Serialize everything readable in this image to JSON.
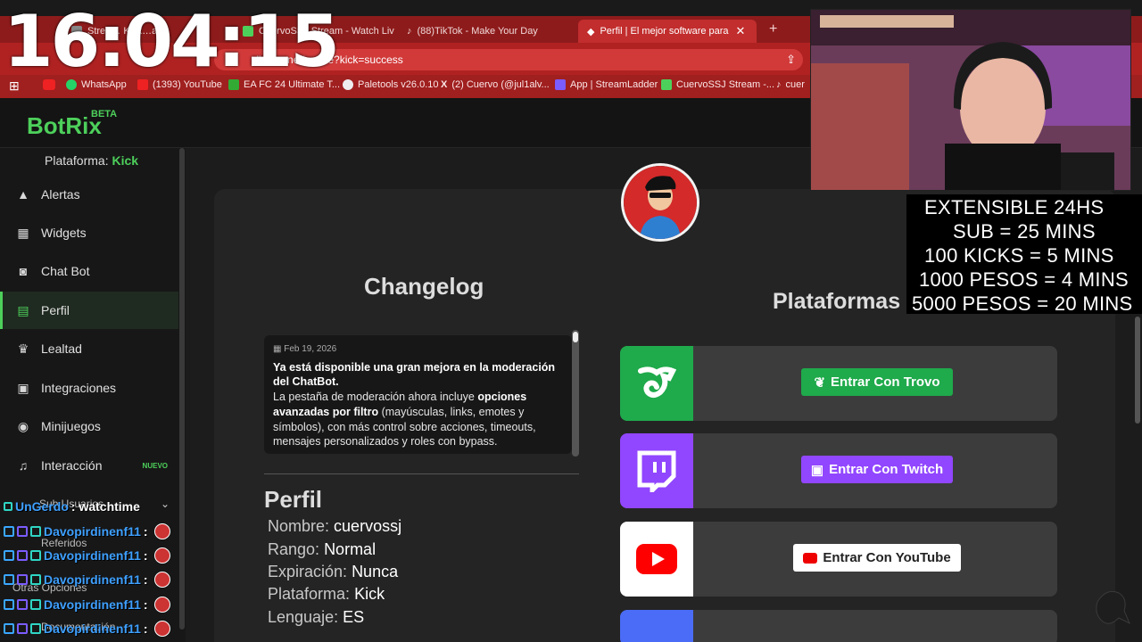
{
  "clock": "16:04:15",
  "browser": {
    "tabs": [
      {
        "label": "Strea… Kick…ash"
      },
      {
        "label": "CuervoSSJ Stream - Watch Live o"
      },
      {
        "label": "(88)TikTok - Make Your Day"
      },
      {
        "label": "Perfil | El mejor software para po"
      }
    ],
    "url": "botrix.live/panel/profile?kick=success",
    "url_visible": ".live/panel/profile?kick=success",
    "bookmarks": [
      {
        "label": "WhatsApp"
      },
      {
        "label": "(1393) YouTube"
      },
      {
        "label": "EA FC 24 Ultimate T..."
      },
      {
        "label": "Paletools v26.0.10"
      },
      {
        "label": "(2) Cuervo (@jul1alv..."
      },
      {
        "label": "App | StreamLadder"
      },
      {
        "label": "CuervoSSJ Stream -..."
      },
      {
        "label": "cuer"
      }
    ]
  },
  "app": {
    "logo": "BotRix",
    "beta": "BETA",
    "platform_label": "Plataforma:",
    "platform_value": "Kick"
  },
  "sidebar": {
    "items": [
      {
        "label": "Alertas",
        "icon": "warning-icon"
      },
      {
        "label": "Widgets",
        "icon": "grid-icon"
      },
      {
        "label": "Chat Bot",
        "icon": "robot-icon"
      },
      {
        "label": "Perfil",
        "icon": "id-card-icon",
        "active": true
      },
      {
        "label": "Lealtad",
        "icon": "trophy-icon"
      },
      {
        "label": "Integraciones",
        "icon": "integration-icon"
      },
      {
        "label": "Minijuegos",
        "icon": "gamepad-icon"
      },
      {
        "label": "Interacción",
        "icon": "music-icon",
        "badge": "NUEVO"
      }
    ],
    "hidden_items": [
      "Sub Usuarios",
      "Referidos",
      "Otras Opciones",
      "Documentación"
    ]
  },
  "chat": {
    "first": {
      "user": "UnGerdo",
      "text": ": watchtime"
    },
    "rows": [
      {
        "user": "Davopirdinenf11",
        "colon": ":"
      },
      {
        "user": "Davopirdinenf11",
        "colon": ":"
      },
      {
        "user": "Davopirdinenf11",
        "colon": ":"
      },
      {
        "user": "Davopirdinenf11",
        "colon": ":"
      },
      {
        "user": "Davopirdinenf11",
        "colon": ":"
      }
    ]
  },
  "changelog": {
    "title": "Changelog",
    "date": "Feb 19, 2026",
    "headline": "Ya está disponible una gran mejora en la moderación del ChatBot.",
    "body_1": "La pestaña de moderación ahora incluye",
    "body_bold": "opciones avanzadas por filtro",
    "body_2": "(mayúsculas, links, emotes y símbolos), con más control sobre acciones, timeouts, mensajes personalizados y roles con bypass."
  },
  "perfil": {
    "title": "Perfil",
    "fields": [
      {
        "label": "Nombre:",
        "value": "cuervossj"
      },
      {
        "label": "Rango:",
        "value": "Normal"
      },
      {
        "label": "Expiración:",
        "value": "Nunca"
      },
      {
        "label": "Plataforma:",
        "value": "Kick"
      },
      {
        "label": "Lenguaje:",
        "value": "ES"
      }
    ]
  },
  "plataformas": {
    "title": "Plataformas",
    "items": [
      {
        "name": "Trovo",
        "button": "Entrar Con Trovo",
        "color": "#1faa4b"
      },
      {
        "name": "Twitch",
        "button": "Entrar Con Twitch",
        "color": "#9146ff"
      },
      {
        "name": "YouTube",
        "button": "Entrar Con YouTube",
        "color": "#ff0000"
      }
    ]
  },
  "overlay": {
    "lines": [
      "EXTENSIBLE 24HS",
      "SUB = 25 MINS",
      "100 KICKS = 5 MINS",
      "1000 PESOS = 4 MINS",
      "5000 PESOS = 20 MINS"
    ]
  }
}
